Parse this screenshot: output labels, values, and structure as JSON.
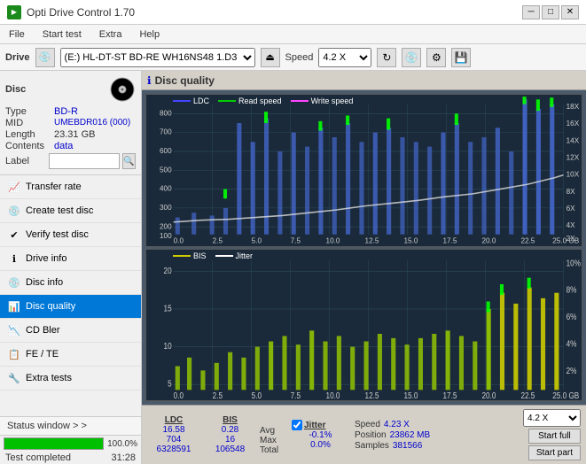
{
  "app": {
    "title": "Opti Drive Control 1.70",
    "icon": "ODC"
  },
  "titlebar": {
    "minimize": "─",
    "maximize": "□",
    "close": "✕"
  },
  "menu": {
    "items": [
      "File",
      "Start test",
      "Extra",
      "Help"
    ]
  },
  "drivebar": {
    "label": "Drive",
    "drive_value": "(E:)  HL-DT-ST BD-RE  WH16NS48 1.D3",
    "speed_label": "Speed",
    "speed_value": "4.2 X"
  },
  "disc": {
    "header": "Disc",
    "type_label": "Type",
    "type_value": "BD-R",
    "mid_label": "MID",
    "mid_value": "UMEBDR016 (000)",
    "length_label": "Length",
    "length_value": "23.31 GB",
    "contents_label": "Contents",
    "contents_value": "data",
    "label_label": "Label",
    "label_value": ""
  },
  "nav": {
    "items": [
      {
        "id": "transfer-rate",
        "label": "Transfer rate",
        "icon": "📈"
      },
      {
        "id": "create-test",
        "label": "Create test disc",
        "icon": "💿"
      },
      {
        "id": "verify-test",
        "label": "Verify test disc",
        "icon": "✔"
      },
      {
        "id": "drive-info",
        "label": "Drive info",
        "icon": "ℹ"
      },
      {
        "id": "disc-info",
        "label": "Disc info",
        "icon": "💿"
      },
      {
        "id": "disc-quality",
        "label": "Disc quality",
        "icon": "📊",
        "active": true
      },
      {
        "id": "cd-bler",
        "label": "CD Bler",
        "icon": "📉"
      },
      {
        "id": "fe-te",
        "label": "FE / TE",
        "icon": "📋"
      },
      {
        "id": "extra-tests",
        "label": "Extra tests",
        "icon": "🔧"
      }
    ]
  },
  "content": {
    "title": "Disc quality",
    "chart1": {
      "legend": [
        {
          "label": "LDC",
          "color": "#4444ff"
        },
        {
          "label": "Read speed",
          "color": "#00cc00"
        },
        {
          "label": "Write speed",
          "color": "#ff44ff"
        }
      ],
      "y_labels_left": [
        "800",
        "700",
        "600",
        "500",
        "400",
        "300",
        "200",
        "100"
      ],
      "y_labels_right": [
        "18X",
        "16X",
        "14X",
        "12X",
        "10X",
        "8X",
        "6X",
        "4X",
        "2X"
      ],
      "x_labels": [
        "0.0",
        "2.5",
        "5.0",
        "7.5",
        "10.0",
        "12.5",
        "15.0",
        "17.5",
        "20.0",
        "22.5",
        "25.0 GB"
      ]
    },
    "chart2": {
      "legend": [
        {
          "label": "BIS",
          "color": "#cccc00"
        },
        {
          "label": "Jitter",
          "color": "#ffffff"
        }
      ],
      "y_labels_left": [
        "20",
        "15",
        "10",
        "5"
      ],
      "y_labels_right": [
        "10%",
        "8%",
        "6%",
        "4%",
        "2%"
      ],
      "x_labels": [
        "0.0",
        "2.5",
        "5.0",
        "7.5",
        "10.0",
        "12.5",
        "15.0",
        "17.5",
        "20.0",
        "22.5",
        "25.0 GB"
      ]
    }
  },
  "stats": {
    "headers": [
      "LDC",
      "BIS",
      "",
      "Jitter",
      "Speed",
      ""
    ],
    "avg_label": "Avg",
    "avg_ldc": "16.58",
    "avg_bis": "0.28",
    "avg_jitter": "-0.1%",
    "max_label": "Max",
    "max_ldc": "704",
    "max_bis": "16",
    "max_jitter": "0.0%",
    "total_label": "Total",
    "total_ldc": "6328591",
    "total_bis": "106548",
    "speed_label": "Speed",
    "speed_value": "4.23 X",
    "position_label": "Position",
    "position_value": "23862 MB",
    "samples_label": "Samples",
    "samples_value": "381566",
    "speed_select": "4.2 X",
    "start_full": "Start full",
    "start_part": "Start part",
    "jitter_checked": true,
    "jitter_label": "Jitter"
  },
  "statusbar": {
    "status_window_label": "Status window > >",
    "progress_percent": "100.0%",
    "status_text": "Test completed",
    "time": "31:28"
  }
}
